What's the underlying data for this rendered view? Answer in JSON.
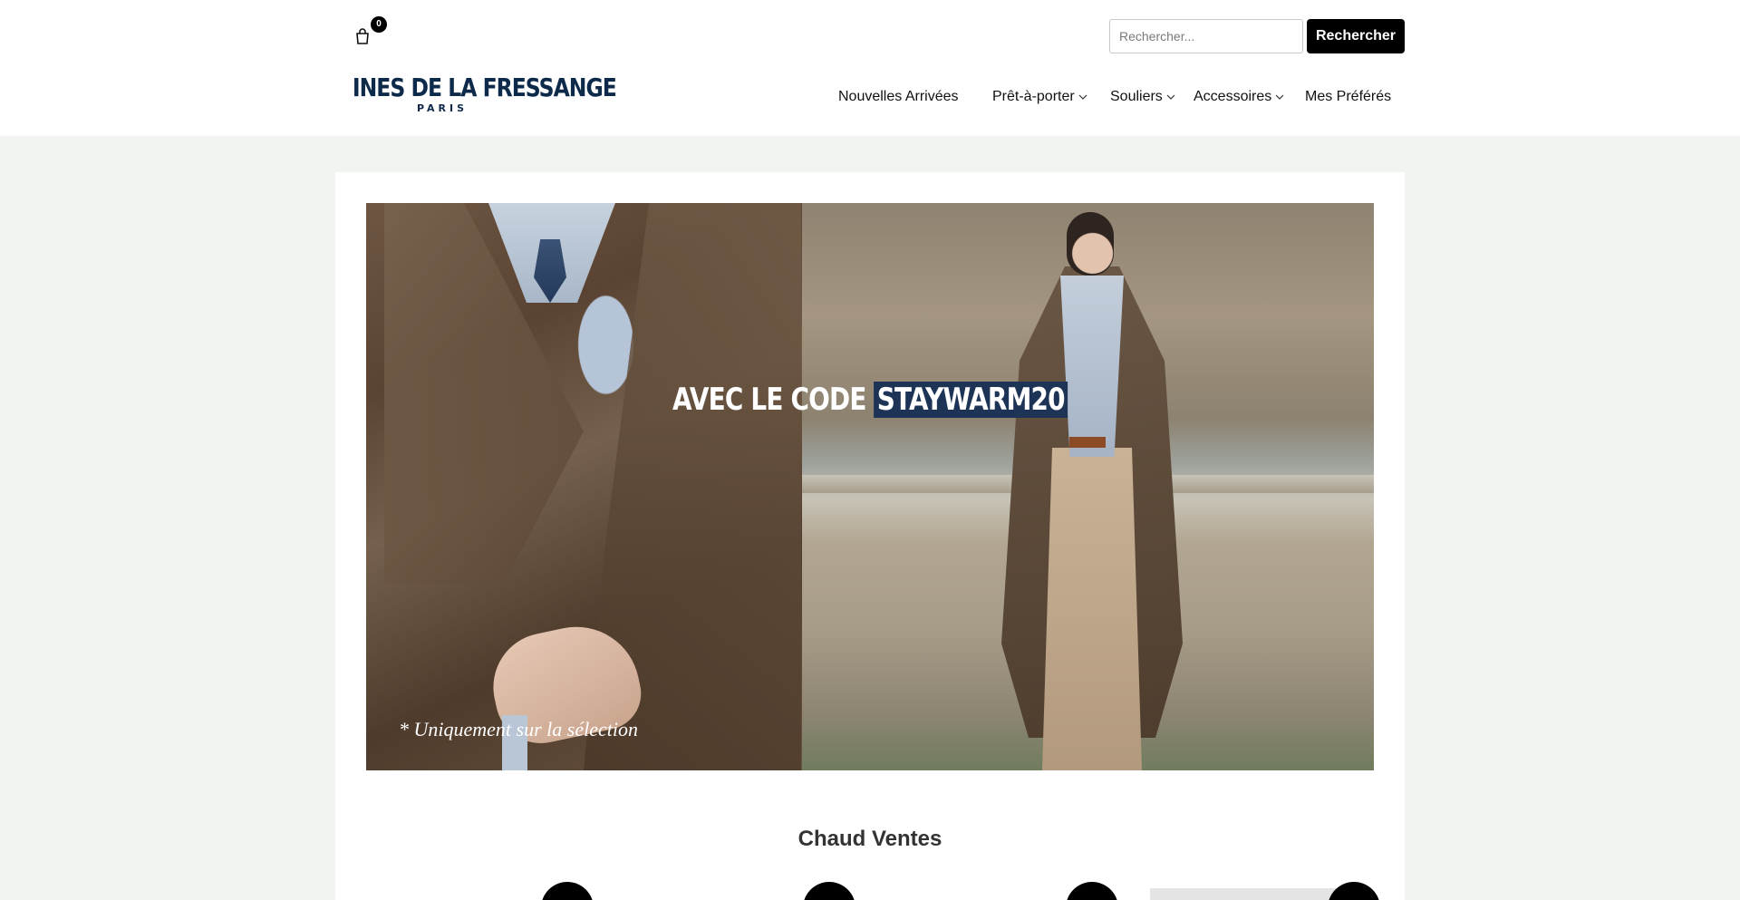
{
  "header": {
    "cart": {
      "icon": "shopping-bag-icon",
      "count": "0"
    },
    "search": {
      "placeholder": "Rechercher...",
      "button_label": "Rechercher"
    },
    "logo": {
      "main": "INES DE LA FRESSANGE",
      "sub": "PARIS"
    },
    "nav": [
      {
        "label": "Nouvelles Arrivées",
        "has_dropdown": false
      },
      {
        "label": "Prêt-à-porter",
        "has_dropdown": true
      },
      {
        "label": "Souliers",
        "has_dropdown": true
      },
      {
        "label": "Accessoires",
        "has_dropdown": true
      },
      {
        "label": "Mes Préférés",
        "has_dropdown": false
      }
    ]
  },
  "banner": {
    "headline_prefix": "AVEC LE CODE",
    "promo_code": "STAYWARM20",
    "note": "* Uniquement sur la sélection"
  },
  "section": {
    "title": "Chaud Ventes"
  },
  "colors": {
    "brand_navy": "#0e2a4a",
    "promo_highlight": "#1d3457",
    "page_bg": "#f1f4f1",
    "button_black": "#000000"
  }
}
